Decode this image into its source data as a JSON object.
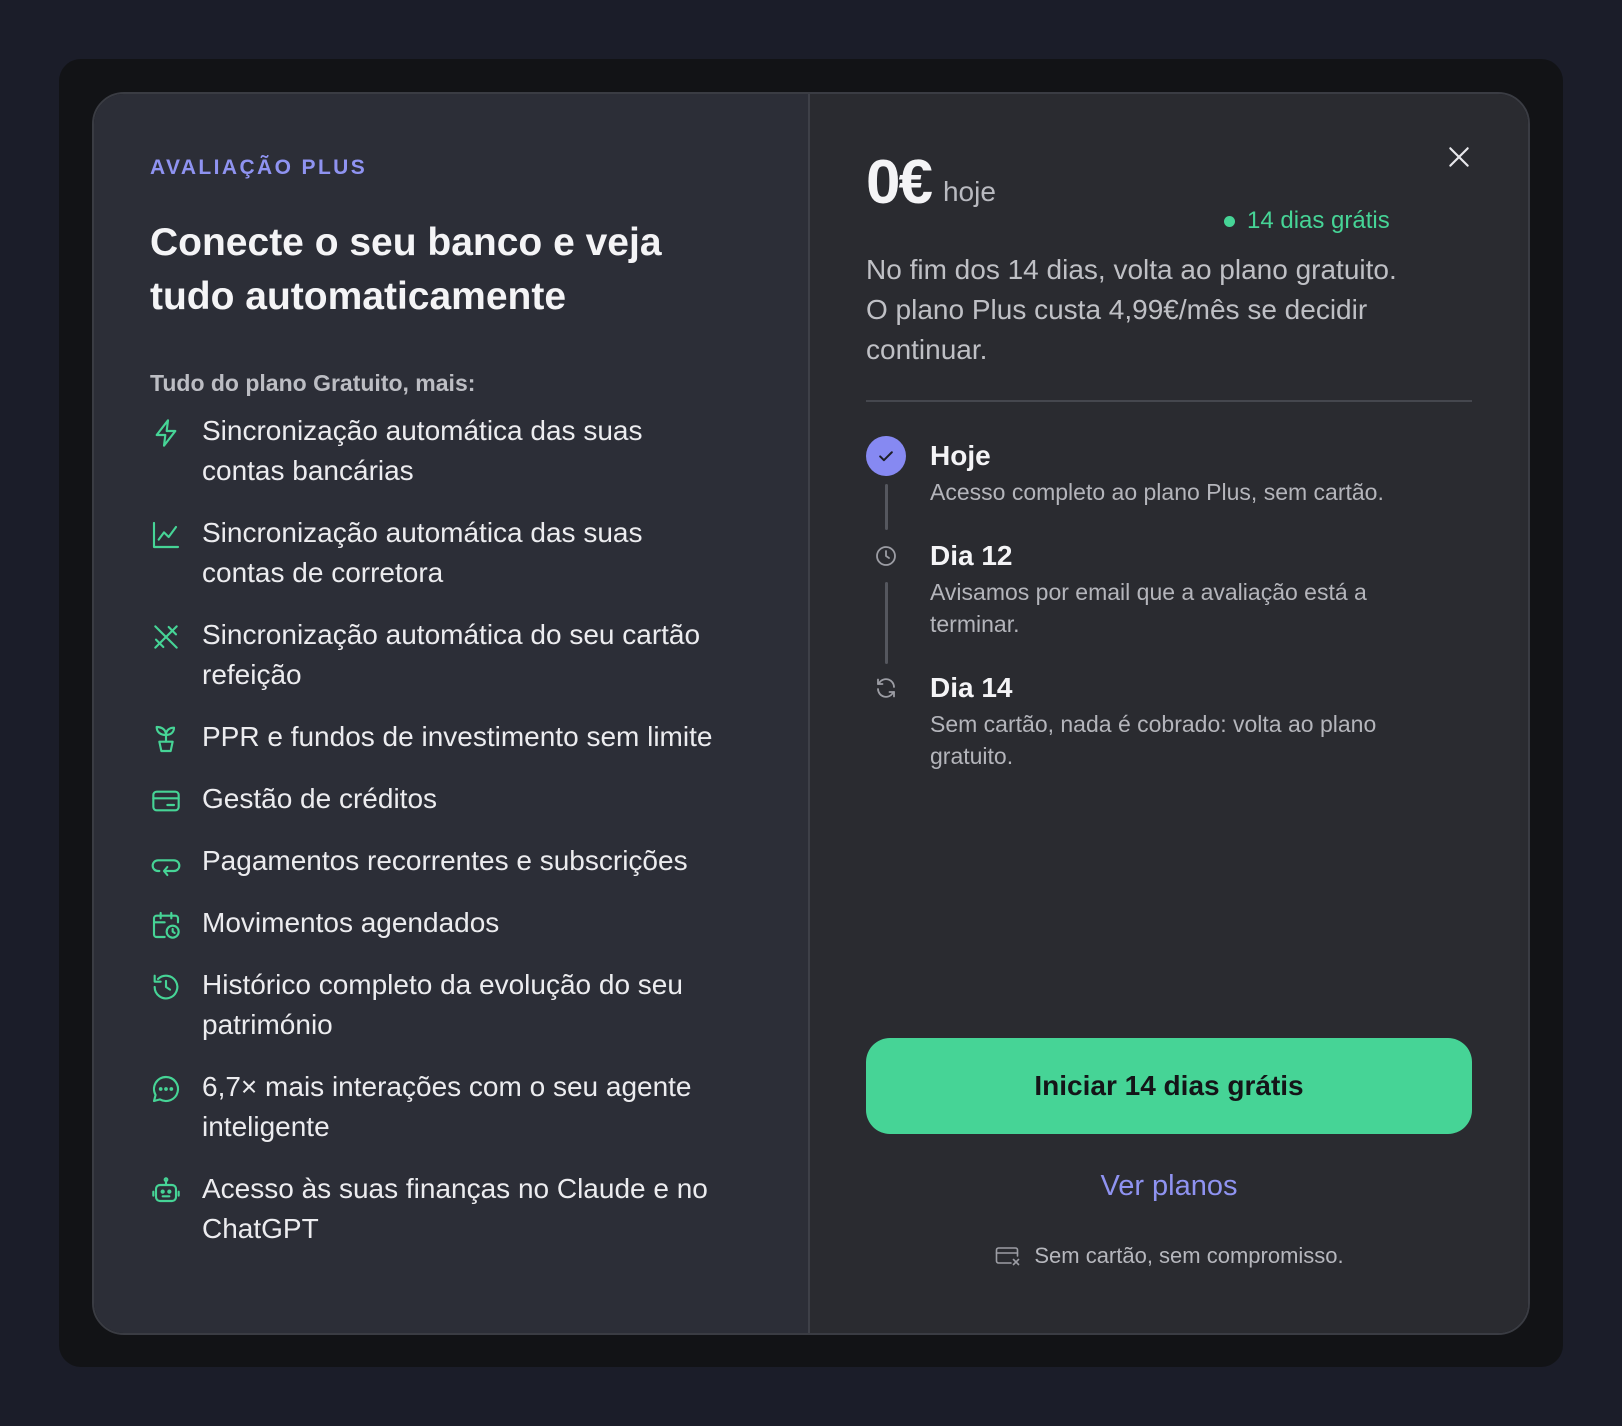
{
  "left": {
    "eyebrow": "AVALIAÇÃO PLUS",
    "headline": "Conecte o seu banco e veja tudo automaticamente",
    "subhead": "Tudo do plano Gratuito, mais:",
    "features": [
      {
        "icon": "bolt-icon",
        "text": "Sincronização automática das suas contas bancárias"
      },
      {
        "icon": "chart-line-icon",
        "text": "Sincronização automática das suas contas de corretora"
      },
      {
        "icon": "utensils-icon",
        "text": "Sincronização automática do seu cartão refeição"
      },
      {
        "icon": "sprout-icon",
        "text": "PPR e fundos de investimento sem limite"
      },
      {
        "icon": "credit-card-icon",
        "text": "Gestão de créditos"
      },
      {
        "icon": "repeat-icon",
        "text": "Pagamentos recorrentes e subscrições"
      },
      {
        "icon": "calendar-clock-icon",
        "text": "Movimentos agendados"
      },
      {
        "icon": "history-icon",
        "text": "Histórico completo da evolução do seu património"
      },
      {
        "icon": "message-icon",
        "text": "6,7× mais interações com o seu agente inteligente"
      },
      {
        "icon": "robot-icon",
        "text": "Acesso às suas finanças no Claude e no ChatGPT"
      }
    ]
  },
  "right": {
    "price": "0€",
    "price_unit": "hoje",
    "badge": "14 dias grátis",
    "description": "No fim dos 14 dias, volta ao plano gratuito. O plano Plus custa 4,99€/mês se decidir continuar.",
    "timeline": [
      {
        "icon": "check-icon",
        "title": "Hoje",
        "desc": "Acesso completo ao plano Plus, sem cartão."
      },
      {
        "icon": "clock-icon",
        "title": "Dia 12",
        "desc": "Avisamos por email que a avaliação está a terminar."
      },
      {
        "icon": "refresh-icon",
        "title": "Dia 14",
        "desc": "Sem cartão, nada é cobrado: volta ao plano gratuito."
      }
    ],
    "cta": "Iniciar 14 dias grátis",
    "link": "Ver planos",
    "footnote": "Sem cartão, sem compromisso."
  },
  "colors": {
    "accent_purple": "#8f93f1",
    "accent_green": "#46d496",
    "left_panel": "#2c2e37",
    "right_panel": "#2a2b30"
  }
}
